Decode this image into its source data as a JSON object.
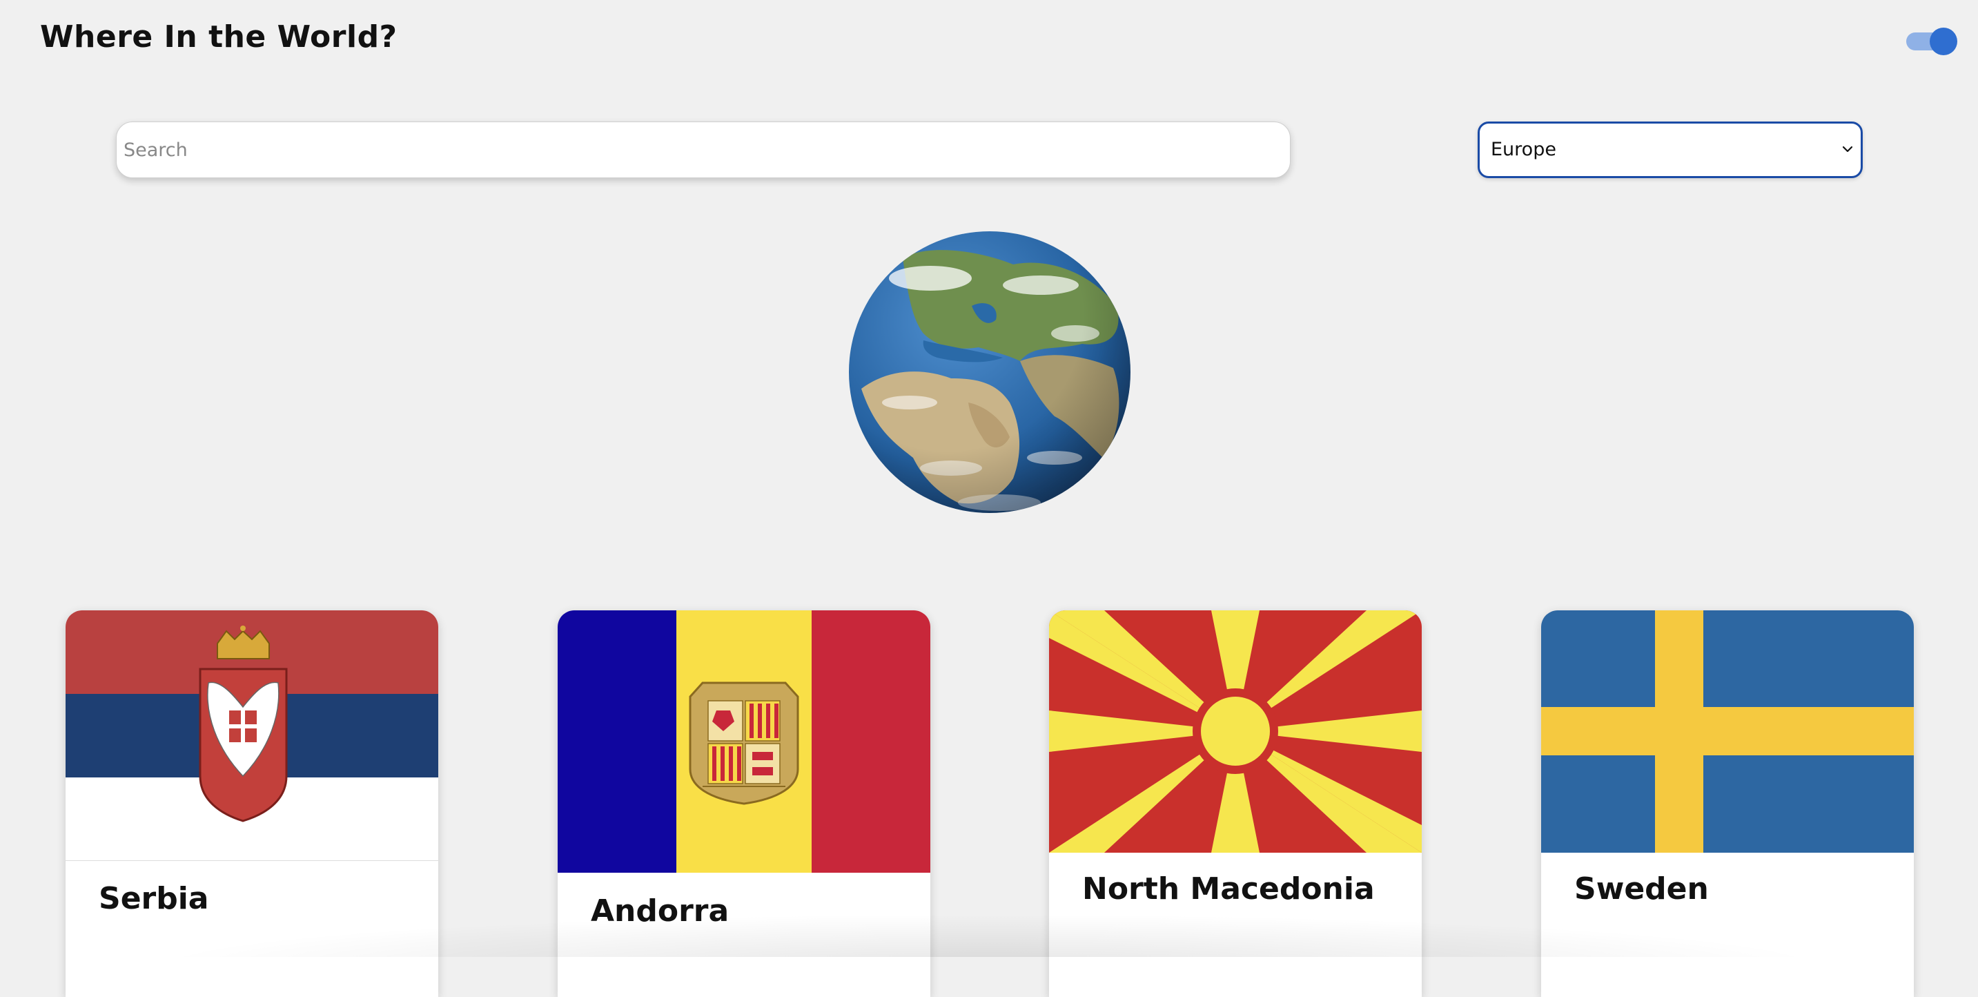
{
  "header": {
    "title": "Where In the World?",
    "theme_toggle_icon": "toggle-switch-on"
  },
  "controls": {
    "search_placeholder": "Search",
    "search_value": "",
    "region_selected": "Europe",
    "select_icon": "chevron-down-icon"
  },
  "hero": {
    "image": "globe"
  },
  "countries": [
    {
      "name": "Serbia",
      "flag_icon": "serbia-flag"
    },
    {
      "name": "Andorra",
      "flag_icon": "andorra-flag"
    },
    {
      "name": "North Macedonia",
      "flag_icon": "north-macedonia-flag"
    },
    {
      "name": "Sweden",
      "flag_icon": "sweden-flag"
    }
  ],
  "colors": {
    "background": "#f0f0f0",
    "accent": "#2f6ed0",
    "select_border": "#1a4ba6"
  }
}
